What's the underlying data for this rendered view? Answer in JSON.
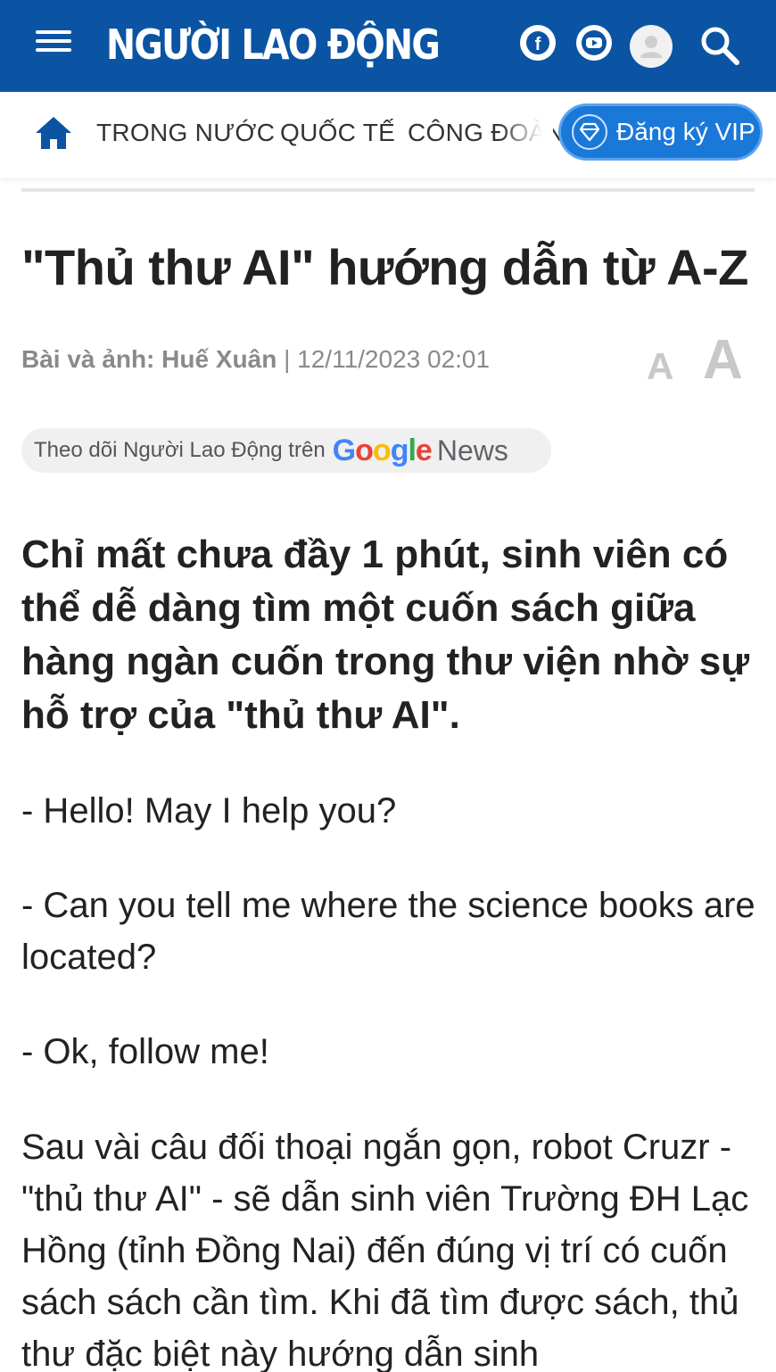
{
  "header": {
    "logo": "NGƯỜI LAO ĐỘNG",
    "facebook_glyph": "f",
    "icons": [
      "menu-icon",
      "facebook-icon",
      "youtube-icon",
      "user-icon",
      "search-icon"
    ],
    "bg_color": "#0b54a4"
  },
  "nav": {
    "items": [
      "TRONG NƯỚC",
      "QUỐC TẾ",
      "CÔNG ĐOÀN"
    ],
    "vip_label": "Đăng ký VIP",
    "vip_color": "#1a78d8"
  },
  "article": {
    "title": "\"Thủ thư AI\" hướng dẫn từ A-Z",
    "byline_prefix": "Bài và ảnh:",
    "author": "Huế Xuân",
    "separator": "|",
    "datetime": "12/11/2023 02:01",
    "font_small": "A",
    "font_large": "A",
    "follow_text": "Theo dõi Người Lao Động trên",
    "google_letters": [
      "G",
      "o",
      "o",
      "g",
      "l",
      "e"
    ],
    "news_word": "News",
    "sapo": "Chỉ mất chưa đầy 1 phút, sinh viên có thể dễ dàng tìm một cuốn sách giữa hàng ngàn cuốn trong thư viện nhờ sự hỗ trợ của \"thủ thư AI\".",
    "paragraphs": [
      "- Hello! May I help you?",
      "- Can you tell me where the science books are located?",
      "- Ok, follow me!",
      "Sau vài câu đối thoại ngắn gọn, robot Cruzr - \"thủ thư AI\" - sẽ dẫn sinh viên Trường ĐH Lạc Hồng (tỉnh Đồng Nai) đến đúng vị trí có cuốn sách sách cần tìm. Khi đã tìm được sách, thủ thư đặc biệt này hướng dẫn sinh"
    ]
  }
}
